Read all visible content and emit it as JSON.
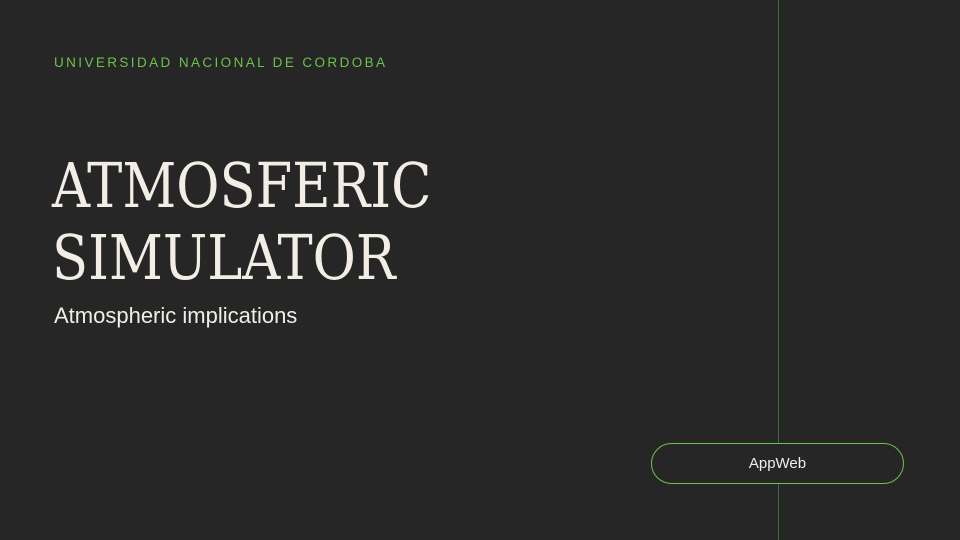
{
  "slide": {
    "organization": "UNIVERSIDAD NACIONAL DE CORDOBA",
    "title_line1": "ATMOSFERIC",
    "title_line2": "SIMULATOR",
    "subtitle": "Atmospheric implications",
    "button_label": "AppWeb"
  },
  "colors": {
    "background": "#262626",
    "accent": "#6cc24a",
    "text": "#f2eee6"
  }
}
